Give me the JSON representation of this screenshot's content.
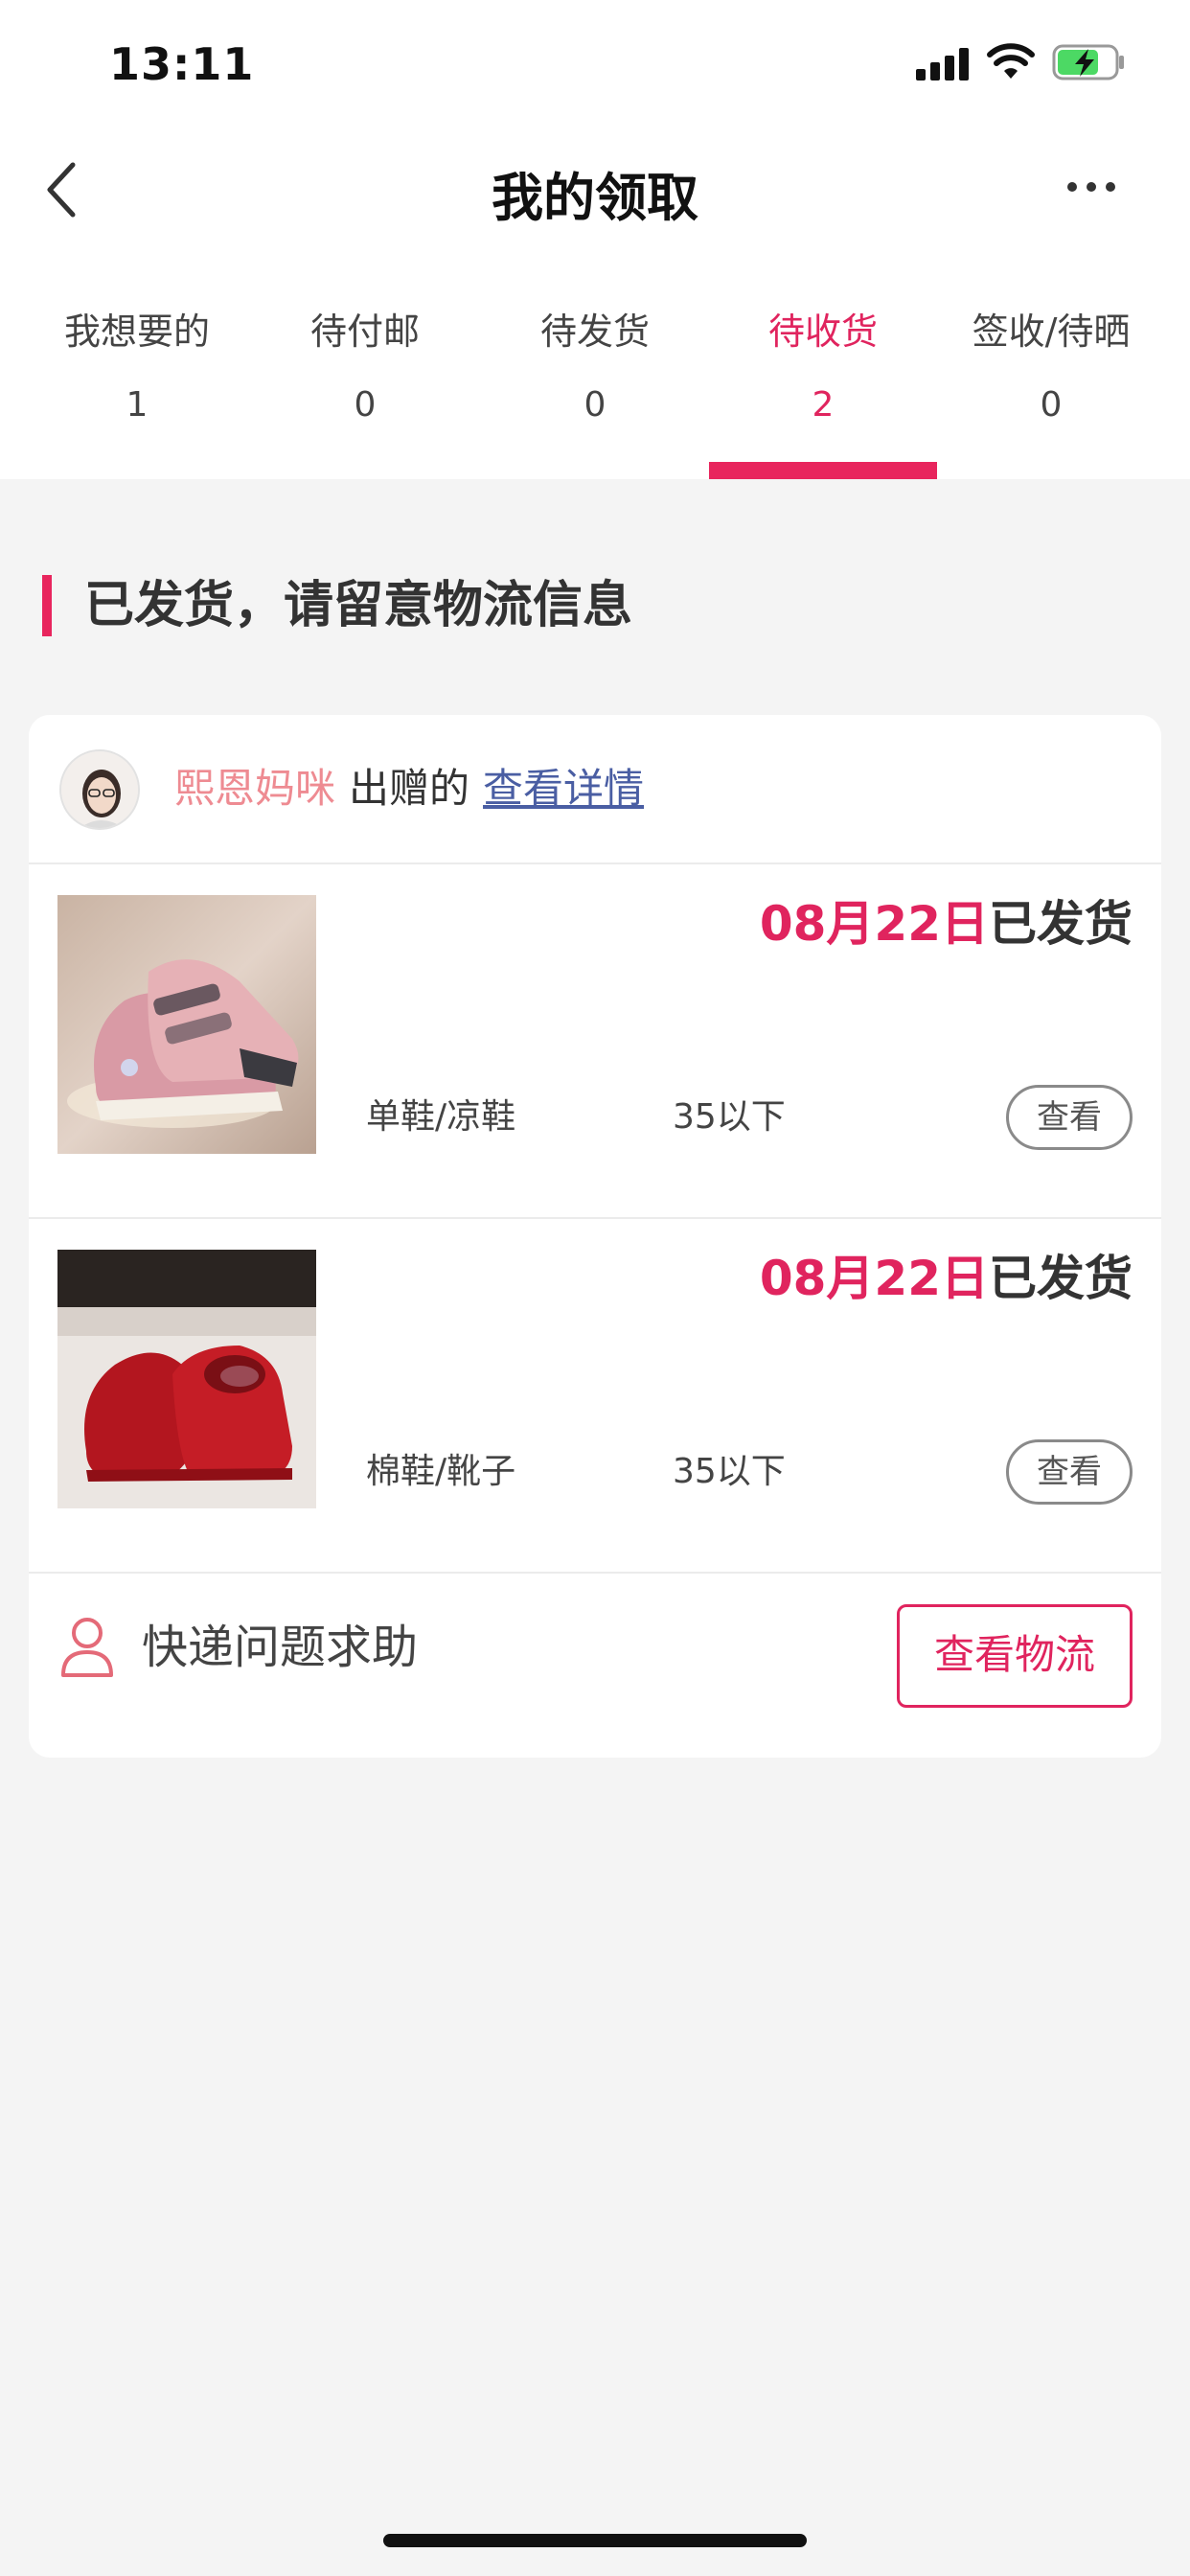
{
  "status_bar": {
    "time": "13:11"
  },
  "nav": {
    "title": "我的领取"
  },
  "tabs": [
    {
      "label": "我想要的",
      "count": "1"
    },
    {
      "label": "待付邮",
      "count": "0"
    },
    {
      "label": "待发货",
      "count": "0"
    },
    {
      "label": "待收货",
      "count": "2"
    },
    {
      "label": "签收/待晒",
      "count": "0"
    }
  ],
  "active_tab": "待收货",
  "section": {
    "title": "已发货，请留意物流信息"
  },
  "card": {
    "donor_name": "熙恩妈咪",
    "donor_suffix": "出赠的",
    "detail_link": "查看详情",
    "items": [
      {
        "date": "08月22日",
        "status": "已发货",
        "category": "单鞋/凉鞋",
        "size": "35以下",
        "view_label": "查看",
        "image": "pink-sneakers"
      },
      {
        "date": "08月22日",
        "status": "已发货",
        "category": "棉鞋/靴子",
        "size": "35以下",
        "view_label": "查看",
        "image": "red-cotton-shoes"
      }
    ],
    "help_label": "快递问题求助",
    "logistics_label": "查看物流"
  },
  "colors": {
    "accent": "#e8255d",
    "donor_name": "#ee8b92",
    "link": "#4a5ea3",
    "background": "#f4f4f4"
  },
  "icons": [
    "back-icon",
    "more-icon",
    "signal-icon",
    "wifi-icon",
    "battery-icon",
    "person-icon"
  ]
}
